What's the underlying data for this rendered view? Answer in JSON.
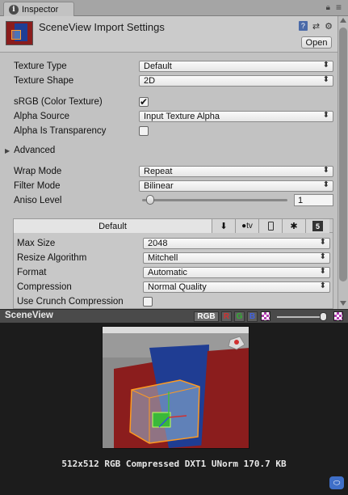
{
  "tab": {
    "title": "Inspector"
  },
  "header": {
    "title": "SceneView Import Settings",
    "open_label": "Open"
  },
  "fields": {
    "texture_type": {
      "label": "Texture Type",
      "value": "Default"
    },
    "texture_shape": {
      "label": "Texture Shape",
      "value": "2D"
    },
    "srgb": {
      "label": "sRGB (Color Texture)",
      "checked": true,
      "mark": "✔"
    },
    "alpha_source": {
      "label": "Alpha Source",
      "value": "Input Texture Alpha"
    },
    "alpha_transparency": {
      "label": "Alpha Is Transparency",
      "checked": false
    },
    "advanced": {
      "label": "Advanced"
    },
    "wrap_mode": {
      "label": "Wrap Mode",
      "value": "Repeat"
    },
    "filter_mode": {
      "label": "Filter Mode",
      "value": "Bilinear"
    },
    "aniso_level": {
      "label": "Aniso Level",
      "value": "1"
    }
  },
  "platform": {
    "tabs": {
      "default": "Default",
      "tv": "tv"
    },
    "max_size": {
      "label": "Max Size",
      "value": "2048"
    },
    "resize_algorithm": {
      "label": "Resize Algorithm",
      "value": "Mitchell"
    },
    "format": {
      "label": "Format",
      "value": "Automatic"
    },
    "compression": {
      "label": "Compression",
      "value": "Normal Quality"
    },
    "crunch": {
      "label": "Use Crunch Compression",
      "checked": false
    }
  },
  "preview": {
    "title": "SceneView",
    "channels": {
      "rgb": "RGB",
      "r": "R",
      "g": "G",
      "b": "B"
    },
    "info": "512x512  RGB Compressed DXT1 UNorm  170.7 KB"
  },
  "colors": {
    "channel_r": "#d03030",
    "channel_g": "#30b030",
    "channel_b": "#4060e0"
  }
}
